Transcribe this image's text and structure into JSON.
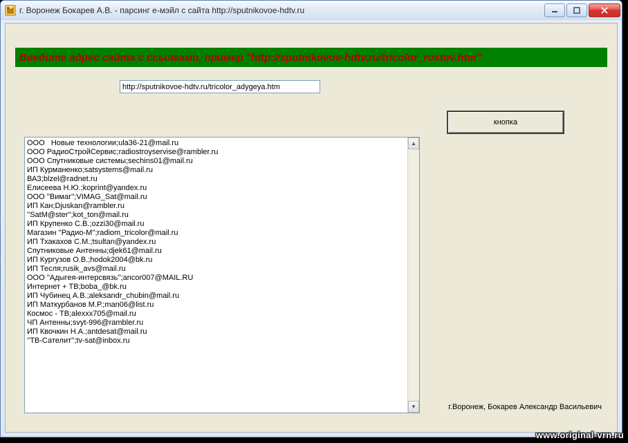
{
  "window": {
    "title": "г. Воронеж Бокарев А.В. - парсинг е-мэйл с сайта  http://sputnikovoe-hdtv.ru"
  },
  "banner": {
    "text": "Введите адрес сайта с ссылками, пример \"http://sputnikovoe-hdtv.ru/tricolor_rostov.htm\""
  },
  "url_input": {
    "value": "http://sputnikovoe-hdtv.ru/tricolor_adygeya.htm"
  },
  "button": {
    "label": "кнопка"
  },
  "memo_lines": [
    "ООО   Новые технологии;ula36-21@mail.ru",
    "ООО РадиоСтройСервис;radiostroyservise@rambler.ru",
    "ООО Спутниковые системы;sechins01@mail.ru",
    "ИП Курманенко;satsystems@mail.ru",
    "ВАЗ;blzel@radnet.ru",
    "Елисеева Н.Ю.;koprint@yandex.ru",
    "ООО ''Вимаг'';VIMAG_Sat@mail.ru",
    "ИП Кан;Djuskan@rambler.ru",
    "''SatM@ster'';kot_ton@mail.ru",
    "ИП Крупенко С.В.;ozzi30@mail.ru",
    "Магазин ''Радио-М'';radiom_tricolor@mail.ru",
    "ИП Тхакахов С.М.;tsultan@yandex.ru",
    "Спутниковые Антенны;djek61@mail.ru",
    "ИП Кургузов О.В.;hodok2004@bk.ru",
    "ИП Тесля;rusik_avs@mail.ru",
    "ООО ''Адыгея-интерсвязь'';ancor007@MAIL.RU",
    "Интернет + ТВ;boba_@bk.ru",
    "ИП Чубинец А.В.;aleksandr_chubin@mail.ru",
    "ИП Маткурбанов М.Р.;man06@list.ru",
    "Космос - ТВ;alexxx705@mail.ru",
    "ЧП Антенны;svyt-996@rambler.ru",
    "ИП Квочкин Н.А.;antdesat@mail.ru",
    "''ТВ-Сателит'';tv-sat@inbox.ru"
  ],
  "footer": {
    "text": "г.Воронеж, Бокарев Александр Васильевич"
  },
  "watermark": "www.original-vrn.ru"
}
